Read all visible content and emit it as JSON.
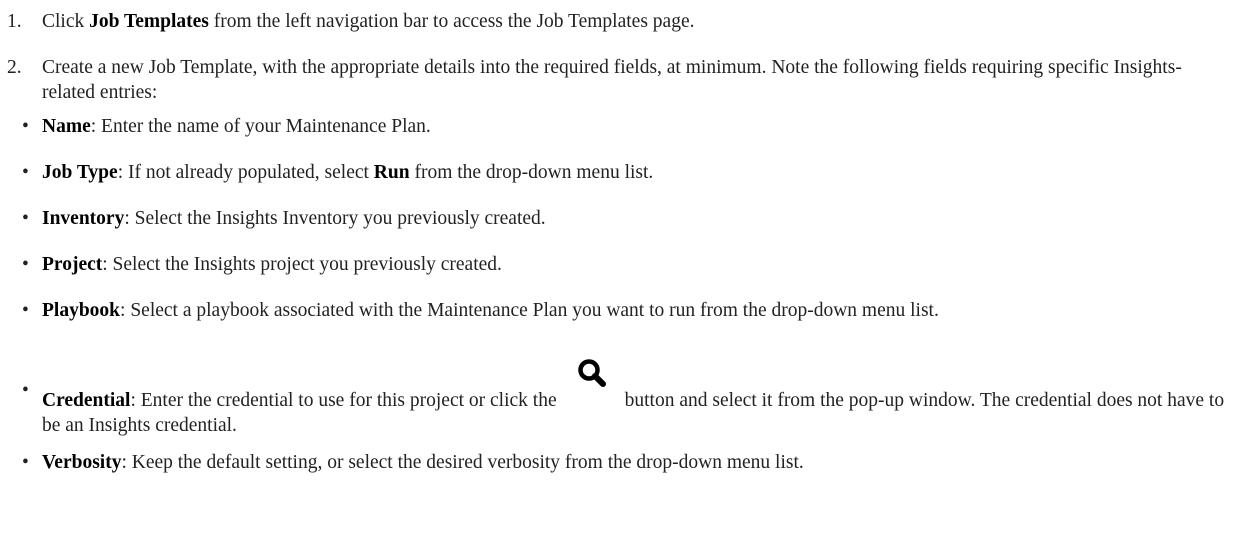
{
  "steps": [
    {
      "number": "1.",
      "pre": "Click ",
      "bold": "Job Templates",
      "post": " from the left navigation bar to access the Job Templates page."
    },
    {
      "number": "2.",
      "text": "Create a new Job Template, with the appropriate details into the required fields, at minimum. Note the following fields requiring specific Insights-related entries:"
    }
  ],
  "bullets": [
    {
      "term": "Name",
      "text": ": Enter the name of your Maintenance Plan."
    },
    {
      "term": "Job Type",
      "text_pre": ": If not already populated, select ",
      "bold2": "Run",
      "text_post": " from the drop-down menu list."
    },
    {
      "term": "Inventory",
      "text": ": Select the Insights Inventory you previously created."
    },
    {
      "term": "Project",
      "text": ": Select the Insights project you previously created."
    },
    {
      "term": "Playbook",
      "text": ": Select a playbook associated with the Maintenance Plan you want to run from the drop-down menu list."
    },
    {
      "term": "Credential",
      "text_pre": ": Enter the credential to use for this project or click the",
      "icon": "search-icon",
      "text_post": "button and select it from the pop-up window. The credential does not have to be an Insights credential."
    },
    {
      "term": "Verbosity",
      "text": ": Keep the default setting, or select the desired verbosity from the drop-down menu list."
    }
  ],
  "bullet_char": "•"
}
